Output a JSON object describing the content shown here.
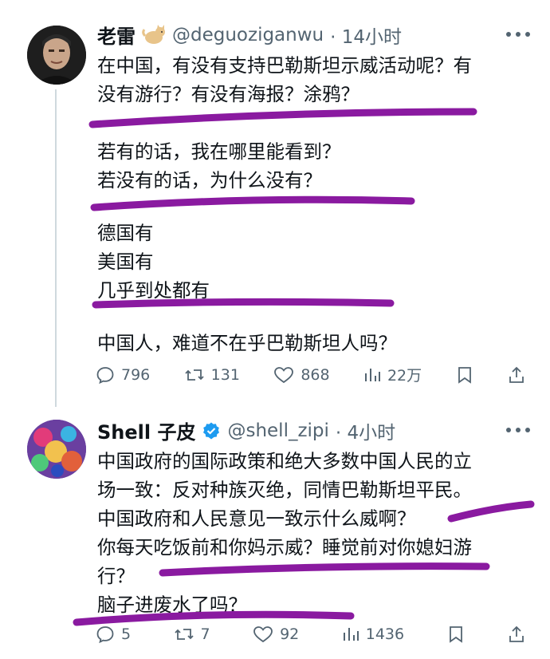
{
  "tweet1": {
    "name": "老雷",
    "emoji_icon": "cat-emoji-icon",
    "handle": "@deguoziganwu",
    "time": "· 14小时",
    "lines": [
      "在中国，有没有支持巴勒斯坦示威活动呢？有",
      "没有游行？有没有海报？涂鸦？",
      "若有的话，我在哪里能看到？",
      "若没有的话，为什么没有？",
      "德国有",
      "美国有",
      "几乎到处都有",
      "中国人，难道不在乎巴勒斯坦人吗？"
    ],
    "stats": {
      "replies": "796",
      "retweets": "131",
      "likes": "868",
      "views": "22万"
    }
  },
  "tweet2": {
    "name": "Shell 子皮",
    "handle": "@shell_zipi",
    "time": "· 4小时",
    "lines": [
      "中国政府的国际政策和绝大多数中国人民的立",
      "场一致：反对种族灭绝，同情巴勒斯坦平民。",
      "中国政府和人民意见一致示什么威啊？",
      "你每天吃饭前和你妈示威？睡觉前对你媳妇游",
      "行？",
      "脑子进废水了吗？"
    ],
    "stats": {
      "replies": "5",
      "retweets": "7",
      "likes": "92",
      "views": "1436"
    }
  },
  "colors": {
    "highlight": "#8a1aa0",
    "verified": "#1d9bf0",
    "muted": "#536471",
    "thread_line": "#cfd9de"
  }
}
